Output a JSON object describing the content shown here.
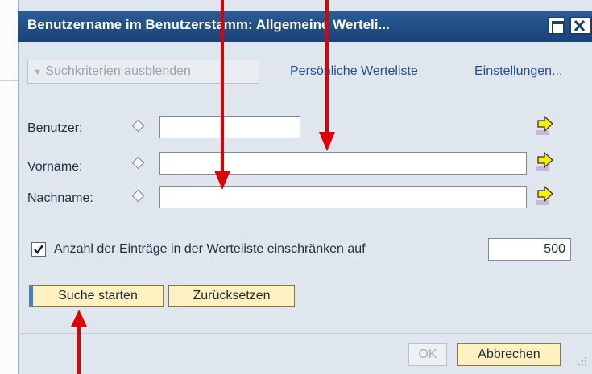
{
  "window": {
    "title": "Benutzername im Benutzerstamm: Allgemeine Werteli...",
    "maximize_icon": "maximize-icon",
    "close_icon": "close-icon"
  },
  "toolbar": {
    "toggle_label": "Suchkriterien ausblenden",
    "personal_list_link": "Persönliche Werteliste",
    "settings_link": "Einstellungen..."
  },
  "form": {
    "fields": [
      {
        "label": "Benutzer:",
        "value": "",
        "icon": "diamond-icon",
        "nav_icon": "yellow-arrow-icon"
      },
      {
        "label": "Vorname:",
        "value": "",
        "icon": "diamond-icon",
        "nav_icon": "yellow-arrow-icon"
      },
      {
        "label": "Nachname:",
        "value": "",
        "icon": "diamond-icon",
        "nav_icon": "yellow-arrow-icon"
      }
    ],
    "limit": {
      "checked": true,
      "label": "Anzahl der Einträge in der Werteliste einschränken auf",
      "value": "500"
    }
  },
  "actions": {
    "search_label": "Suche starten",
    "reset_label": "Zurücksetzen",
    "ok_label": "OK",
    "cancel_label": "Abbrechen"
  },
  "colors": {
    "title_bar": "#1f4a82",
    "dialog_bg": "#dfe6ed",
    "button_bg": "#fff2c0",
    "annotation_arrow": "#e00000"
  }
}
